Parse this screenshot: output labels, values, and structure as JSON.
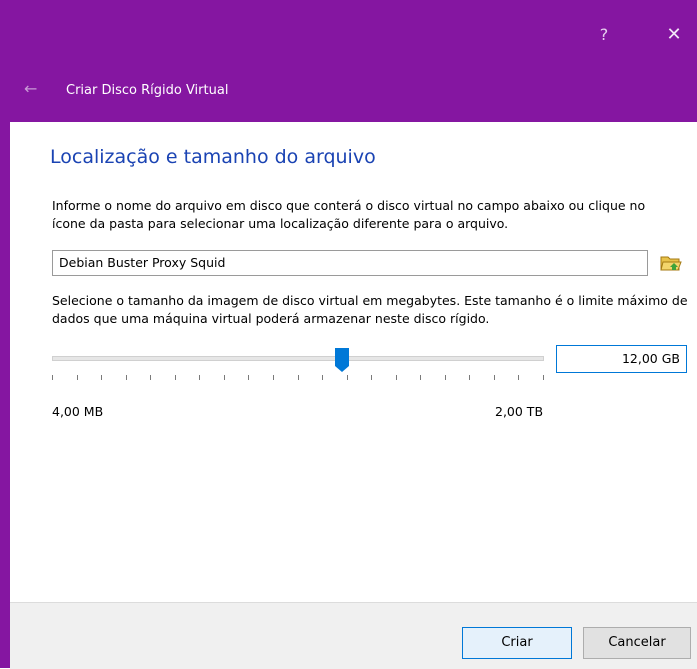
{
  "window": {
    "title": "Criar Disco Rígido Virtual",
    "help_icon": "?",
    "close_icon": "✕",
    "back_icon": "←"
  },
  "content": {
    "heading": "Localização e tamanho do arquivo",
    "file_description": "Informe o nome do arquivo em disco que conterá o disco virtual no campo abaixo ou clique no ícone da pasta para selecionar uma localização diferente para o arquivo.",
    "file_name": "Debian Buster Proxy Squid",
    "size_description": "Selecione o tamanho da imagem de disco virtual em megabytes. Este tamanho é o limite máximo de dados que uma máquina virtual poderá armazenar neste disco rígido.",
    "size_value": "12,00 GB",
    "slider_position_fraction": 0.59,
    "range_min": "4,00 MB",
    "range_max": "2,00 TB"
  },
  "footer": {
    "create_label": "Criar",
    "cancel_label": "Cancelar"
  }
}
